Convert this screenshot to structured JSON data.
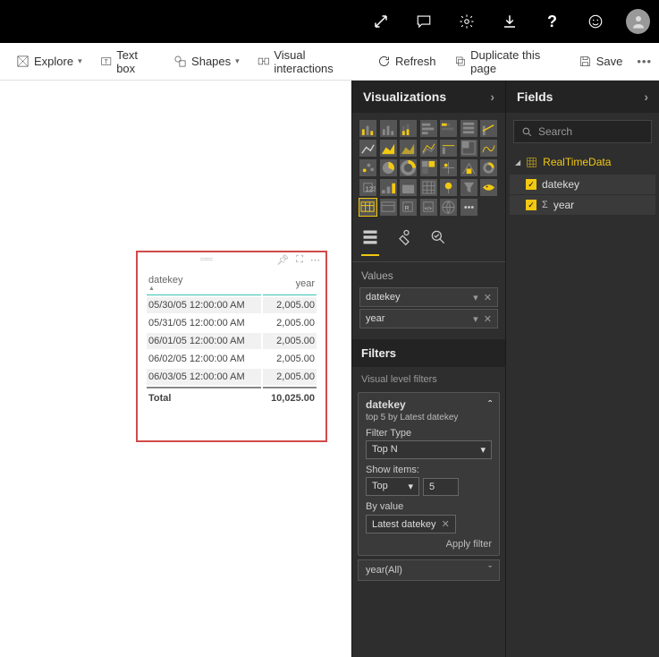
{
  "topbar": {
    "icons": [
      "expand",
      "chat",
      "settings",
      "download",
      "help",
      "feedback",
      "avatar"
    ]
  },
  "toolbar": {
    "explore": "Explore",
    "textbox": "Text box",
    "shapes": "Shapes",
    "visual_interactions": "Visual interactions",
    "refresh": "Refresh",
    "duplicate": "Duplicate this page",
    "save": "Save"
  },
  "visual": {
    "columns": [
      "datekey",
      "year"
    ],
    "rows": [
      {
        "datekey": "05/30/05 12:00:00 AM",
        "year": "2,005.00",
        "zebra": true
      },
      {
        "datekey": "05/31/05 12:00:00 AM",
        "year": "2,005.00",
        "zebra": false
      },
      {
        "datekey": "06/01/05 12:00:00 AM",
        "year": "2,005.00",
        "zebra": true
      },
      {
        "datekey": "06/02/05 12:00:00 AM",
        "year": "2,005.00",
        "zebra": false
      },
      {
        "datekey": "06/03/05 12:00:00 AM",
        "year": "2,005.00",
        "zebra": true
      }
    ],
    "total_label": "Total",
    "total_value": "10,025.00"
  },
  "viz_panel": {
    "title": "Visualizations",
    "values_label": "Values",
    "value_fields": [
      "datekey",
      "year"
    ],
    "filters_title": "Filters",
    "visual_filters_label": "Visual level filters",
    "filter": {
      "field": "datekey",
      "summary": "top 5 by Latest datekey",
      "filter_type_label": "Filter Type",
      "filter_type": "Top N",
      "show_items_label": "Show items:",
      "direction": "Top",
      "count": "5",
      "by_value_label": "By value",
      "by_value": "Latest datekey",
      "apply": "Apply filter"
    },
    "filter2": "year(All)"
  },
  "fields_panel": {
    "title": "Fields",
    "search_placeholder": "Search",
    "table": "RealTimeData",
    "fields": [
      {
        "name": "datekey",
        "agg": false
      },
      {
        "name": "year",
        "agg": true
      }
    ]
  }
}
